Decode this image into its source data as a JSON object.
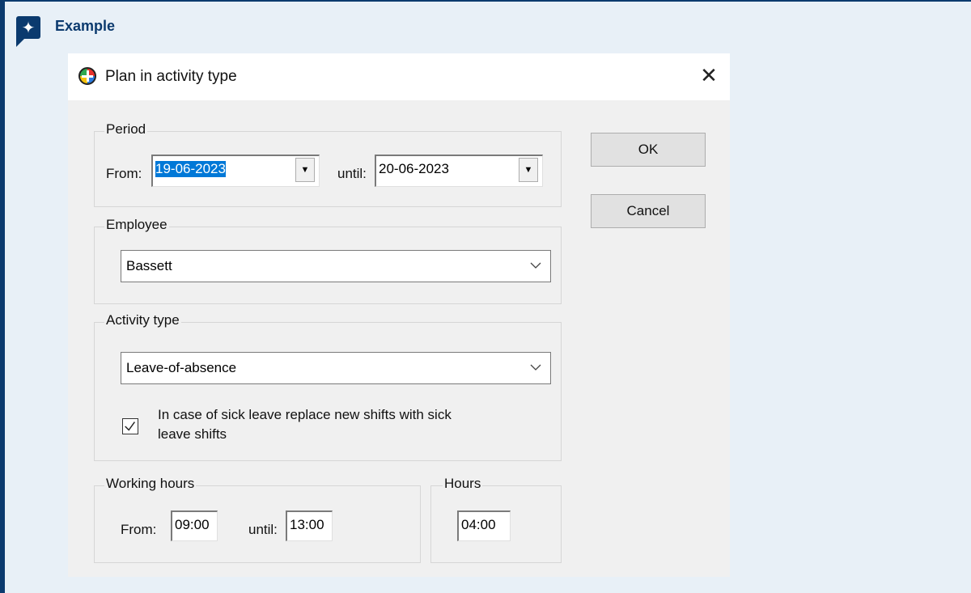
{
  "callout": {
    "title": "Example",
    "icon": "sparkle-icon",
    "accent": "#0b3a6e",
    "background": "#e8f0f7"
  },
  "dialog": {
    "title": "Plan in activity type",
    "period": {
      "label": "Period",
      "from_label": "From:",
      "from_value": "19-06-2023",
      "until_label": "until:",
      "until_value": "20-06-2023"
    },
    "employee": {
      "label": "Employee",
      "value": "Bassett"
    },
    "activity": {
      "label": "Activity type",
      "value": "Leave-of-absence",
      "checkbox_line1": "In case of sick leave replace new shifts with sick",
      "checkbox_line2": "leave shifts",
      "checkbox_checked": true
    },
    "working_hours": {
      "label": "Working hours",
      "from_label": "From:",
      "from_value": "09:00",
      "until_label": "until:",
      "until_value": "13:00"
    },
    "hours": {
      "label": "Hours",
      "value": "04:00"
    },
    "ok_label": "OK",
    "cancel_label": "Cancel"
  }
}
